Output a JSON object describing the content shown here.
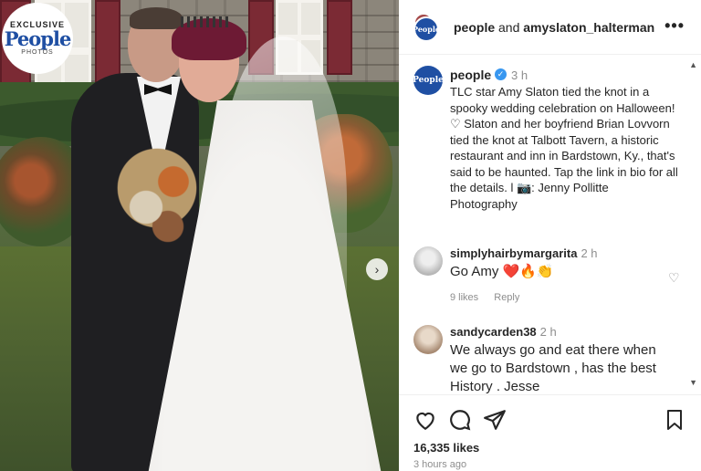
{
  "photo": {
    "badge": {
      "exclusive": "EXCLUSIVE",
      "brand": "People",
      "photos": "PHOTOS"
    },
    "next_icon": "chevron-right-icon"
  },
  "header": {
    "user1": "people",
    "and": "and",
    "user2": "amyslaton_halterman",
    "more_icon": "more-icon",
    "more_label": "•••"
  },
  "caption": {
    "avatar_text": "People",
    "username": "people",
    "verified_glyph": "✓",
    "time": "3 h",
    "text": "TLC star Amy Slaton tied the knot in a spooky wedding celebration on Halloween! ♡ Slaton and her boyfriend Brian Lovvorn tied the knot at Talbott Tavern, a historic restaurant and inn in Bardstown, Ky., that's said to be haunted. Tap the link in bio for all the details. l 📷: Jenny Pollitte Photography"
  },
  "comments": [
    {
      "username": "simplyhairbymargarita",
      "time": "2 h",
      "text": "Go Amy ❤️🔥👏",
      "likes": "9 likes",
      "reply": "Reply"
    },
    {
      "username": "sandycarden38",
      "time": "2 h",
      "text": "We always go and eat there when we go to Bardstown , has the best History . Jesse"
    }
  ],
  "actions": {
    "icons": [
      "heart-icon",
      "comment-icon",
      "share-icon",
      "bookmark-icon"
    ],
    "likes": "16,335 likes",
    "posted": "3 hours ago"
  },
  "colors": {
    "brand_blue": "#1f4fa3",
    "verified_blue": "#3897f0",
    "muted": "#8e8e8e"
  }
}
